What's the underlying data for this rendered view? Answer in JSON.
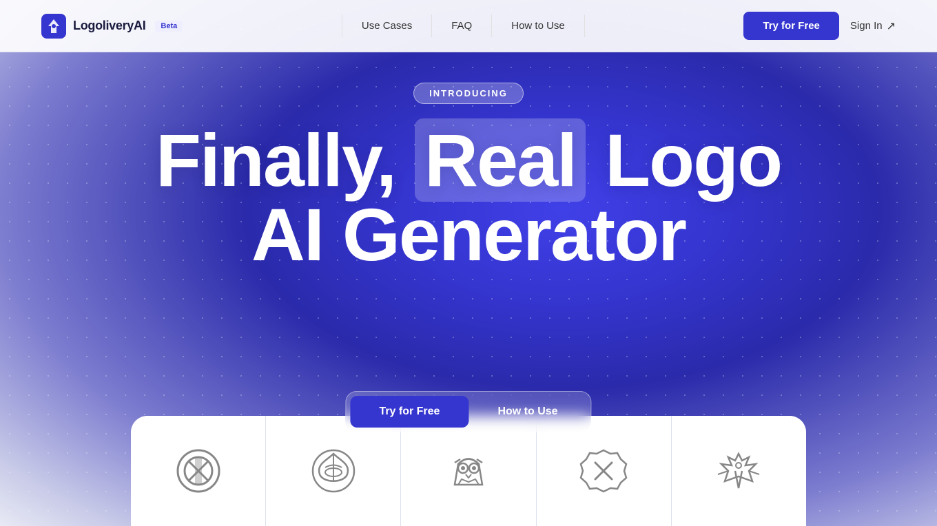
{
  "nav": {
    "logo_text": "LogoliveryAI",
    "beta_label": "Beta",
    "links": [
      {
        "id": "use-cases",
        "label": "Use Cases"
      },
      {
        "id": "faq",
        "label": "FAQ"
      },
      {
        "id": "how-to-use",
        "label": "How to Use"
      }
    ],
    "try_free_label": "Try for Free",
    "sign_in_label": "Sign In"
  },
  "hero": {
    "badge_label": "INTRODUCING",
    "title_line1_prefix": "Finally, ",
    "title_line1_highlight": "Real",
    "title_line1_suffix": " Logo",
    "title_line2": "AI Generator"
  },
  "cta": {
    "primary_label": "Try for Free",
    "secondary_label": "How to Use"
  },
  "logo_strip": {
    "cards": [
      {
        "id": "logo-1",
        "name": "abstract-circles-logo"
      },
      {
        "id": "logo-2",
        "name": "ship-compass-logo"
      },
      {
        "id": "logo-3",
        "name": "owl-logo"
      },
      {
        "id": "logo-4",
        "name": "badge-x-logo"
      },
      {
        "id": "logo-5",
        "name": "eagle-logo"
      }
    ]
  },
  "colors": {
    "primary": "#3535d0",
    "white": "#ffffff",
    "text_dark": "#1a1a3e"
  }
}
